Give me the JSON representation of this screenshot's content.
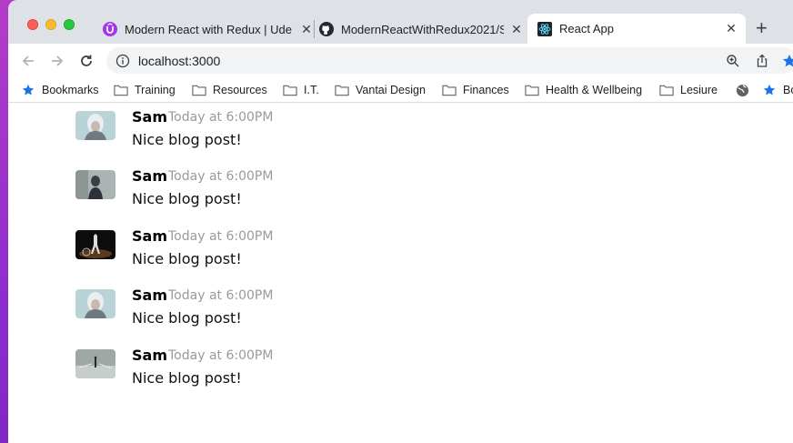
{
  "browser": {
    "tabs": [
      {
        "title": "Modern React with Redux | Ude",
        "favicon": "udemy-icon",
        "color": "#a435f0"
      },
      {
        "title": "ModernReactWithRedux2021/S",
        "favicon": "github-icon",
        "color": "#24292f"
      },
      {
        "title": "React App",
        "favicon": "react-icon",
        "color": "#61dafb",
        "active": true
      }
    ],
    "close_glyph": "✕",
    "new_tab_glyph": "+",
    "url": "localhost:3000"
  },
  "bookmarks": [
    {
      "label": "Bookmarks",
      "icon": "star-icon"
    },
    {
      "label": "Training",
      "icon": "folder-icon"
    },
    {
      "label": "Resources",
      "icon": "folder-icon"
    },
    {
      "label": "I.T.",
      "icon": "folder-icon"
    },
    {
      "label": "Vantai Design",
      "icon": "folder-icon"
    },
    {
      "label": "Finances",
      "icon": "folder-icon"
    },
    {
      "label": "Health & Wellbeing",
      "icon": "folder-icon"
    },
    {
      "label": "Lesiure",
      "icon": "folder-icon"
    },
    {
      "label": "",
      "icon": "globe-icon"
    },
    {
      "label": "Bo",
      "icon": "star-icon"
    }
  ],
  "comments": [
    {
      "author": "Sam",
      "date": "Today at 6:00PM",
      "text": "Nice blog post!",
      "avatar": "avatar-1"
    },
    {
      "author": "Sam",
      "date": "Today at 6:00PM",
      "text": "Nice blog post!",
      "avatar": "avatar-2"
    },
    {
      "author": "Sam",
      "date": "Today at 6:00PM",
      "text": "Nice blog post!",
      "avatar": "avatar-3"
    },
    {
      "author": "Sam",
      "date": "Today at 6:00PM",
      "text": "Nice blog post!",
      "avatar": "avatar-4"
    },
    {
      "author": "Sam",
      "date": "Today at 6:00PM",
      "text": "Nice blog post!",
      "avatar": "avatar-5"
    }
  ]
}
